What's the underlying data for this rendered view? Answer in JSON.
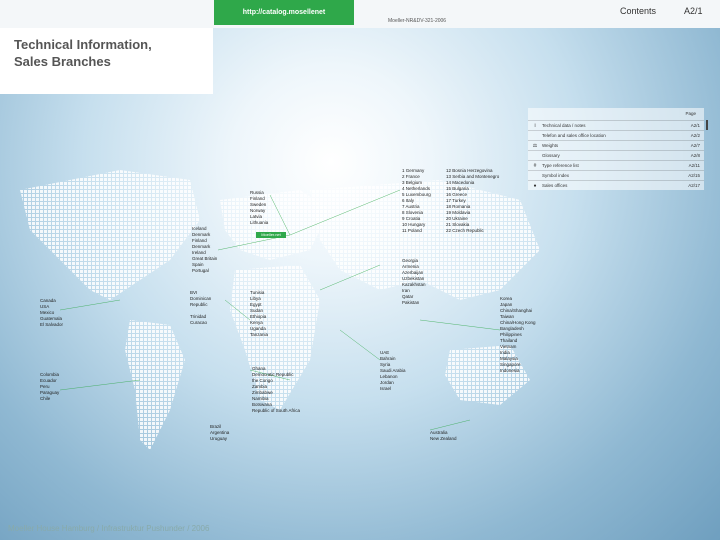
{
  "header": {
    "url": "http://catalog.mosellenet",
    "section": "Contents",
    "page_ref": "A2/1",
    "barcode_text": "Moeller-NR&DV-321-2006"
  },
  "title": {
    "line1": "Technical Information,",
    "line2": "Sales Branches"
  },
  "contents": {
    "heading": "Page",
    "rows": [
      {
        "icon": "info",
        "label": "Technical data / notes",
        "page": "A2/1"
      },
      {
        "icon": "",
        "label": "Telefon and sales office location",
        "page": "A2/2"
      },
      {
        "icon": "scale",
        "label": "Weights",
        "page": "A2/7"
      },
      {
        "icon": "",
        "label": "Glossary",
        "page": "A2/8"
      },
      {
        "icon": "hash",
        "label": "Type reference list",
        "page": "A2/11"
      },
      {
        "icon": "",
        "label": "Symbol index",
        "page": "A2/15"
      },
      {
        "icon": "globe",
        "label": "Sales offices",
        "page": "A2/17"
      }
    ]
  },
  "lists": {
    "numbered_a": "1 Germany\n2 France\n3 Belgium\n4 Netherlands\n5 Luxembourg\n6 Italy\n7 Austria\n8 Slovenia\n9 Croatia\n10 Hungary\n11 Poland",
    "numbered_b": "12 Bosnia Herzegovina\n13 Serbia and Montenegro\n14 Macedonia\n15 Bulgaria\n16 Greece\n17 Turkey\n18 Romania\n19 Moldavia\n20 Ukraine\n21 Slovakia\n22 Czech Republic",
    "north_europe": "Russia\nFinland\nSweden\nNorway\nLatvia\nLithuania",
    "west_europe": "Iceland\nDenmark\nFinland\nDenmark\nIreland\nGreat Britain\nSpain\nPortugal",
    "caucasus": "Georgia\nArmenia\nAzerbaijan\nUzbekistan\nKazakhstan\nIran\nQatar\nPakistan",
    "caribbean": "BVI\nDominican\nRepublic",
    "tunisia_block": "Tunisia\nLibya\nEgypt\nSudan\nEthiopia\nKenya\nUganda\nTanzania",
    "trinidad": "Trinidad\nCuracao",
    "north_america": "Canada\nUSA\nMexico\nGuatemala\nEl Salvador",
    "south_america": "Colombia\nEcuador\nPeru\nParaguay\nChile",
    "africa_south": "Ghana\nDemocratic Republic\nthe Congo\nZambia\nZimbabwe\nNamibia\nBotswana\nRepublic of South Africa",
    "mideast": "UAE\nBahrain\nSyria\nSaudi Arabia\nLebanon\nJordan\nIsrael",
    "asia": "Korea\nJapan\nChina/Shanghai\nTaiwan\nChina/Hong Kong\nBangladesh\nPhilippines\nThailand\nVietnam\nIndia\nMalaysia\nSingapore\nIndonesia",
    "south_atlantic": "Brazil\nArgentina\nUruguay",
    "oceania": "Australia\nNew Zealand",
    "green_tag": "Moeller.net"
  },
  "footer": "Moeller House Hamburg / Infrastruktur Pushunder / 2006"
}
